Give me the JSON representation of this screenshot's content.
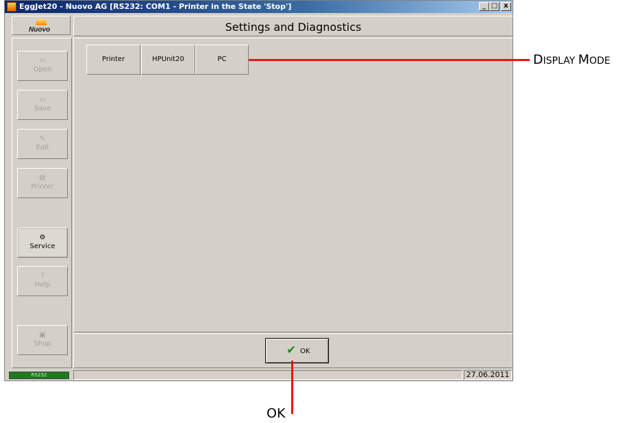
{
  "window": {
    "title": "EggJet20 - Nuovo AG   [RS232: COM1 - Printer in the State 'Stop']",
    "minimize_glyph": "_",
    "restore_glyph": "□",
    "close_glyph": "x"
  },
  "logo": {
    "text": "Nuovo"
  },
  "header": {
    "title": "Settings and Diagnostics"
  },
  "sidebar": {
    "items": [
      {
        "label": "Open",
        "icon": "folder-icon",
        "glyph": "▭",
        "enabled": false
      },
      {
        "label": "Save",
        "icon": "save-icon",
        "glyph": "▭",
        "enabled": false
      },
      {
        "label": "Edit",
        "icon": "edit-icon",
        "glyph": "✎",
        "enabled": false
      },
      {
        "label": "Printer",
        "icon": "printer-icon",
        "glyph": "▤",
        "enabled": false
      },
      {
        "label": "Service",
        "icon": "gear-icon",
        "glyph": "⚙",
        "enabled": true
      },
      {
        "label": "Help",
        "icon": "help-icon",
        "glyph": "?",
        "enabled": false
      },
      {
        "label": "Shop",
        "icon": "shop-icon",
        "glyph": "▣",
        "enabled": false
      }
    ]
  },
  "display_mode": {
    "buttons": [
      "Printer",
      "HPUnit20",
      "PC"
    ]
  },
  "footer": {
    "ok_label": "OK",
    "check_glyph": "✔"
  },
  "status": {
    "connection": "RS232",
    "date": "27.06.2011"
  },
  "annotations": {
    "display_mode_label": {
      "first": "D",
      "rest1": "ISPLAY ",
      "second": "M",
      "rest2": "ODE"
    },
    "ok_label": "OK"
  },
  "colors": {
    "callout": "#ee1111",
    "title_bar": "#0a246a",
    "ok_check": "#1a8a1a",
    "status_connection": "#1f7a1f"
  }
}
